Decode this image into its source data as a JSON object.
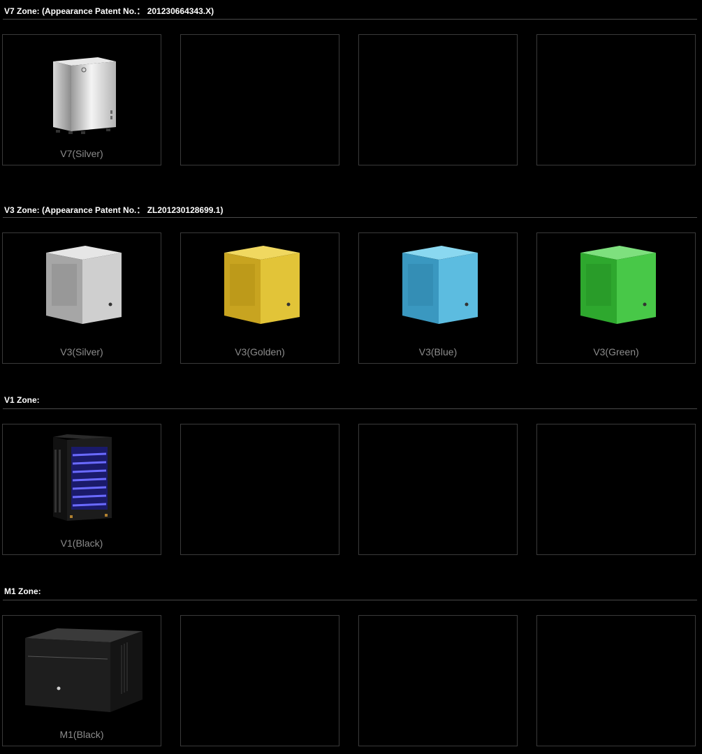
{
  "zones": [
    {
      "title": "V7 Zone: (Appearance Patent No.： 201230664343.X)",
      "products": [
        {
          "label": "V7(Silver)",
          "color": "#c8c8c8"
        }
      ]
    },
    {
      "title": "V3 Zone: (Appearance Patent No.： ZL201230128699.1)",
      "products": [
        {
          "label": "V3(Silver)",
          "color": "#c0c0c0"
        },
        {
          "label": "V3(Golden)",
          "color": "#d8b830"
        },
        {
          "label": "V3(Blue)",
          "color": "#48b0d8"
        },
        {
          "label": "V3(Green)",
          "color": "#40c040"
        }
      ]
    },
    {
      "title": "V1 Zone:",
      "products": [
        {
          "label": "V1(Black)",
          "color": "#1a1a1a",
          "accent": "#3a3ad8"
        }
      ]
    },
    {
      "title": "M1 Zone:",
      "products": [
        {
          "label": "M1(Black)",
          "color": "#262626"
        }
      ]
    }
  ]
}
